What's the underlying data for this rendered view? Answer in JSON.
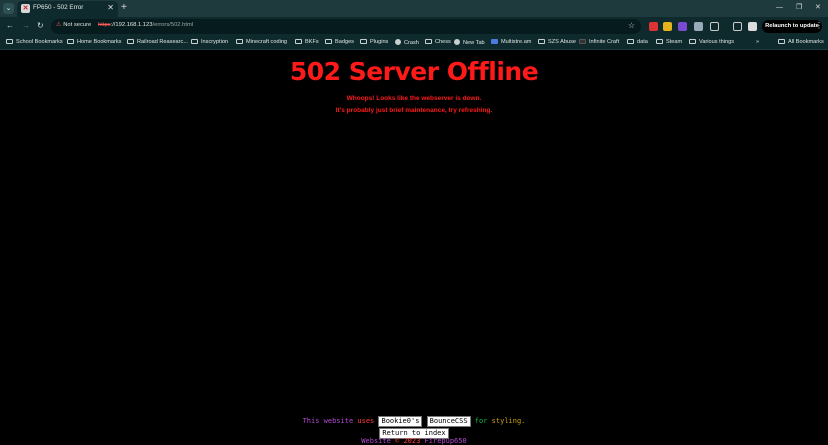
{
  "browser": {
    "tab_title": "FP650 - 502 Error",
    "url_warning": "Not secure",
    "url_scheme": "https",
    "url_host": "://192.168.1.123",
    "url_path": "/errors/502.html",
    "relaunch_label": "Relaunch to update",
    "accent_color": "#0e2a2d"
  },
  "bookmarks": [
    {
      "label": "School Bookmarks",
      "icon": "folder-icon"
    },
    {
      "label": "Home Bookmarks",
      "icon": "folder-icon"
    },
    {
      "label": "Railroad Reasearc...",
      "icon": "folder-icon"
    },
    {
      "label": "Inscryption",
      "icon": "folder-icon"
    },
    {
      "label": "Minecraft coding",
      "icon": "folder-icon"
    },
    {
      "label": "BKFs",
      "icon": "folder-icon"
    },
    {
      "label": "Badges",
      "icon": "folder-icon"
    },
    {
      "label": "Plugins",
      "icon": "folder-icon"
    },
    {
      "label": "Crash",
      "icon": "globe-icon"
    },
    {
      "label": "Chess",
      "icon": "chess-icon"
    },
    {
      "label": "New Tab",
      "icon": "globe-icon"
    },
    {
      "label": "Multistre.am",
      "icon": "site-icon"
    },
    {
      "label": "SZS Abuse",
      "icon": "folder-icon"
    },
    {
      "label": "Infinite Craft",
      "icon": "site-icon"
    },
    {
      "label": "data",
      "icon": "folder-icon"
    },
    {
      "label": "Steam",
      "icon": "folder-icon"
    },
    {
      "label": "Various things",
      "icon": "folder-icon"
    }
  ],
  "all_bookmarks": "All Bookmarks",
  "error": {
    "title": "502 Server Offline",
    "line1": "Whoops! Looks like the webserver is down.",
    "line2": "It's probably just brief maintenance, try refreshing.",
    "color": "#ff1a1a"
  },
  "footer": {
    "this": "This",
    "website": "website",
    "uses": "uses",
    "bookie": "Bookie0's",
    "bounce": "BounceCSS",
    "for": "for",
    "styling": "styling.",
    "return_label": "Return to index",
    "copyright_website": "Website",
    "copyright_mid": "© 2023",
    "copyright_owner": "Firepup650"
  }
}
